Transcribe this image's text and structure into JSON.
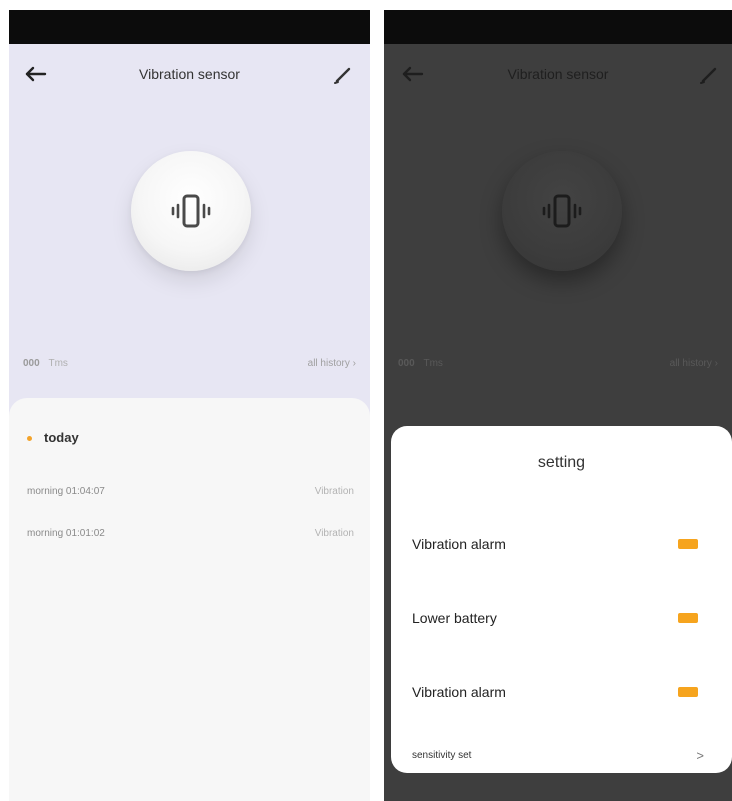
{
  "left_screen": {
    "nav": {
      "title": "Vibration sensor",
      "back_icon": "arrow-left-icon",
      "edit_icon": "pencil-icon"
    },
    "sensor_icon": "vibration-phone-icon",
    "stats": {
      "count": "000",
      "unit": "Tms",
      "link": "all history ›"
    },
    "history": {
      "day_label": "today",
      "entries": [
        {
          "time": "morning 01:04:07",
          "event": "Vibration"
        },
        {
          "time": "morning 01:01:02",
          "event": "Vibration"
        }
      ]
    },
    "colors": {
      "background": "#e7e6f3",
      "accent": "#f3a32a"
    }
  },
  "right_screen": {
    "nav": {
      "title": "Vibration sensor",
      "back_icon": "arrow-left-icon",
      "edit_icon": "pencil-icon"
    },
    "sensor_icon": "vibration-phone-icon",
    "stats": {
      "count": "000",
      "unit": "Tms",
      "link": "all history ›"
    },
    "settings": {
      "title": "setting",
      "items": [
        {
          "label": "Vibration alarm",
          "control": "toggle",
          "on": true
        },
        {
          "label": "Lower battery",
          "control": "toggle",
          "on": true
        },
        {
          "label": "Vibration alarm",
          "control": "toggle",
          "on": true
        },
        {
          "label": "sensitivity set",
          "control": "chevron",
          "chevron": ">"
        }
      ]
    },
    "colors": {
      "overlay_background": "#3e3e3e",
      "toggle_on": "#f6a41e"
    }
  }
}
